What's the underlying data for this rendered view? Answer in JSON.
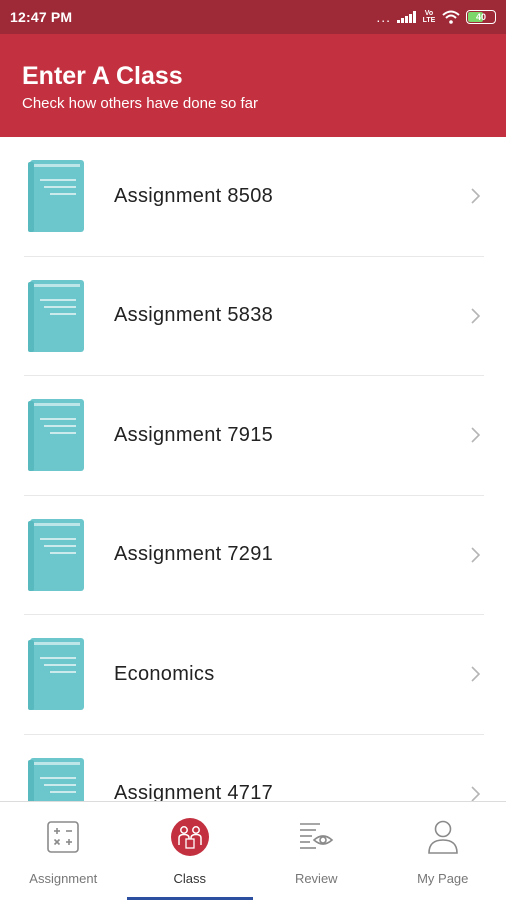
{
  "status_bar": {
    "time": "12:47 PM",
    "dots": "...",
    "volte_top": "Vo",
    "volte_bottom": "LTE",
    "battery": "40"
  },
  "header": {
    "title": "Enter A Class",
    "subtitle": "Check how others have done so far"
  },
  "classes": [
    {
      "label": "Assignment 8508"
    },
    {
      "label": "Assignment 5838"
    },
    {
      "label": "Assignment 7915"
    },
    {
      "label": "Assignment 7291"
    },
    {
      "label": "Economics"
    },
    {
      "label": "Assignment 4717"
    }
  ],
  "bottom_nav": [
    {
      "label": "Assignment",
      "icon": "calculator-icon",
      "active": false
    },
    {
      "label": "Class",
      "icon": "class-group-icon",
      "active": true
    },
    {
      "label": "Review",
      "icon": "review-eye-icon",
      "active": false
    },
    {
      "label": "My Page",
      "icon": "user-icon",
      "active": false
    }
  ],
  "colors": {
    "status_bar": "#9e2937",
    "header": "#c3303f",
    "book_icon": "#6cc7cc",
    "active_indicator": "#2d4fa0"
  }
}
